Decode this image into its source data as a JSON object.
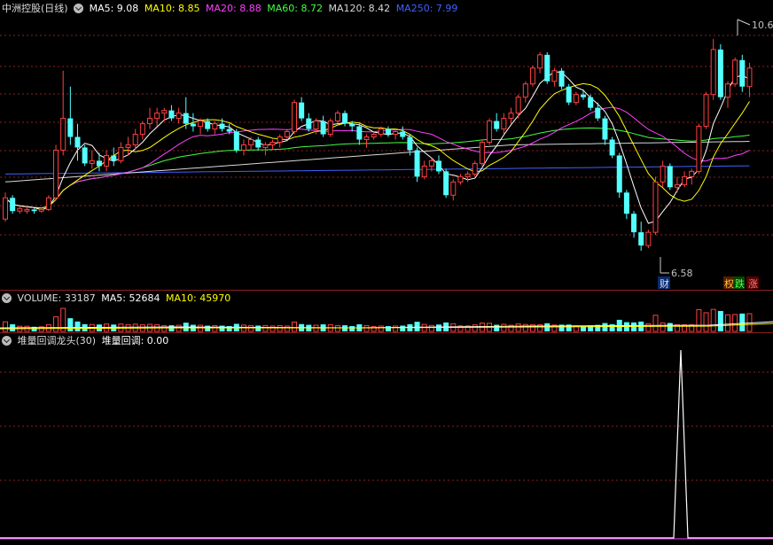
{
  "colors": {
    "up": "#ff4040",
    "down": "#54ffff",
    "grid": "#8a2020",
    "ma5": "#ffffff",
    "ma10": "#ffff00",
    "ma20": "#ff40ff",
    "ma60": "#40ff40",
    "ma120": "#d8d8d8",
    "ma250": "#4060ff"
  },
  "main": {
    "stock_name": "中洲控股(日线)",
    "ma5_label": "MA5: 9.08",
    "ma10_label": "MA10: 8.85",
    "ma20_label": "MA20: 8.88",
    "ma60_label": "MA60: 8.72",
    "ma120_label": "MA120: 8.42",
    "ma250_label": "MA250: 7.99",
    "high_mark": "10.6",
    "low_mark": "6.58",
    "badge_cai": "财",
    "badge_quan": "权",
    "badge_die": "跌",
    "badge_zhang": "涨"
  },
  "volume": {
    "title": "VOLUME: 33187",
    "ma5_label": "MA5: 52684",
    "ma10_label": "MA10: 45970"
  },
  "indicator": {
    "title": "堆量回调龙头(30)",
    "value_label": "堆量回调: 0.00"
  },
  "chart_data": [
    {
      "type": "candlestick",
      "ylim": [
        6.4,
        11.0
      ],
      "candles": [
        [
          7.2,
          7.7,
          7.15,
          7.6
        ],
        [
          7.6,
          7.65,
          7.3,
          7.35
        ],
        [
          7.35,
          7.45,
          7.3,
          7.4
        ],
        [
          7.35,
          7.45,
          7.3,
          7.38
        ],
        [
          7.38,
          7.4,
          7.3,
          7.35
        ],
        [
          7.35,
          7.42,
          7.32,
          7.38
        ],
        [
          7.38,
          7.65,
          7.35,
          7.6
        ],
        [
          7.6,
          8.6,
          7.55,
          8.5
        ],
        [
          8.5,
          10.0,
          8.4,
          9.1
        ],
        [
          9.1,
          9.7,
          8.6,
          8.75
        ],
        [
          8.75,
          9.0,
          8.3,
          8.55
        ],
        [
          8.55,
          8.6,
          8.2,
          8.25
        ],
        [
          8.25,
          8.5,
          8.15,
          8.3
        ],
        [
          8.3,
          8.45,
          8.1,
          8.2
        ],
        [
          8.2,
          8.5,
          8.1,
          8.4
        ],
        [
          8.4,
          8.55,
          8.2,
          8.3
        ],
        [
          8.3,
          8.65,
          8.25,
          8.55
        ],
        [
          8.55,
          8.75,
          8.4,
          8.6
        ],
        [
          8.6,
          8.9,
          8.5,
          8.8
        ],
        [
          8.8,
          9.05,
          8.7,
          9.0
        ],
        [
          9.0,
          9.3,
          8.9,
          9.1
        ],
        [
          9.1,
          9.3,
          8.95,
          9.2
        ],
        [
          9.2,
          9.3,
          9.05,
          9.25
        ],
        [
          9.25,
          9.35,
          9.05,
          9.1
        ],
        [
          9.1,
          9.3,
          9.0,
          9.2
        ],
        [
          9.2,
          9.5,
          8.9,
          9.0
        ],
        [
          9.0,
          9.2,
          8.85,
          8.95
        ],
        [
          8.95,
          9.1,
          8.8,
          9.05
        ],
        [
          9.05,
          9.1,
          8.85,
          8.9
        ],
        [
          8.9,
          9.05,
          8.8,
          9.0
        ],
        [
          9.0,
          9.1,
          8.85,
          8.9
        ],
        [
          8.9,
          9.0,
          8.8,
          8.85
        ],
        [
          8.85,
          8.9,
          8.45,
          8.5
        ],
        [
          8.5,
          8.7,
          8.4,
          8.6
        ],
        [
          8.6,
          8.75,
          8.5,
          8.7
        ],
        [
          8.7,
          8.75,
          8.5,
          8.55
        ],
        [
          8.55,
          8.65,
          8.4,
          8.6
        ],
        [
          8.6,
          8.7,
          8.5,
          8.65
        ],
        [
          8.65,
          8.8,
          8.55,
          8.75
        ],
        [
          8.75,
          8.9,
          8.7,
          8.85
        ],
        [
          8.85,
          9.45,
          8.8,
          9.4
        ],
        [
          9.4,
          9.5,
          9.05,
          9.1
        ],
        [
          9.1,
          9.2,
          8.85,
          8.9
        ],
        [
          8.9,
          9.1,
          8.8,
          9.05
        ],
        [
          9.05,
          9.15,
          8.75,
          8.8
        ],
        [
          8.8,
          9.1,
          8.75,
          9.05
        ],
        [
          9.05,
          9.25,
          9.0,
          9.2
        ],
        [
          9.2,
          9.25,
          8.95,
          9.0
        ],
        [
          9.0,
          9.05,
          8.85,
          8.95
        ],
        [
          8.95,
          9.0,
          8.6,
          8.7
        ],
        [
          8.7,
          8.8,
          8.55,
          8.75
        ],
        [
          8.75,
          8.85,
          8.7,
          8.8
        ],
        [
          8.8,
          8.95,
          8.75,
          8.9
        ],
        [
          8.9,
          8.95,
          8.75,
          8.8
        ],
        [
          8.8,
          8.9,
          8.7,
          8.85
        ],
        [
          8.85,
          8.95,
          8.7,
          8.75
        ],
        [
          8.75,
          8.8,
          8.4,
          8.5
        ],
        [
          8.5,
          8.55,
          7.9,
          8.0
        ],
        [
          8.0,
          8.3,
          7.95,
          8.2
        ],
        [
          8.2,
          8.35,
          8.1,
          8.3
        ],
        [
          8.3,
          8.4,
          8.05,
          8.1
        ],
        [
          8.1,
          8.15,
          7.6,
          7.65
        ],
        [
          7.65,
          7.95,
          7.55,
          7.9
        ],
        [
          7.9,
          8.05,
          7.85,
          8.0
        ],
        [
          8.0,
          8.1,
          7.9,
          8.05
        ],
        [
          8.05,
          8.3,
          8.0,
          8.25
        ],
        [
          8.25,
          8.7,
          8.2,
          8.65
        ],
        [
          8.65,
          9.1,
          8.6,
          9.05
        ],
        [
          9.05,
          9.2,
          8.85,
          8.9
        ],
        [
          8.9,
          9.2,
          8.8,
          9.1
        ],
        [
          9.1,
          9.3,
          9.0,
          9.2
        ],
        [
          9.2,
          9.55,
          9.1,
          9.5
        ],
        [
          9.5,
          9.8,
          9.4,
          9.75
        ],
        [
          9.75,
          10.1,
          9.7,
          10.05
        ],
        [
          10.05,
          10.35,
          9.95,
          10.3
        ],
        [
          10.3,
          10.35,
          9.75,
          9.8
        ],
        [
          9.8,
          10.05,
          9.7,
          10.0
        ],
        [
          10.0,
          10.05,
          9.65,
          9.7
        ],
        [
          9.7,
          9.75,
          9.35,
          9.4
        ],
        [
          9.4,
          9.6,
          9.35,
          9.55
        ],
        [
          9.55,
          9.65,
          9.45,
          9.5
        ],
        [
          9.5,
          9.55,
          9.25,
          9.3
        ],
        [
          9.3,
          9.4,
          9.05,
          9.1
        ],
        [
          9.1,
          9.15,
          8.6,
          8.7
        ],
        [
          8.7,
          8.75,
          8.35,
          8.4
        ],
        [
          8.4,
          8.45,
          7.6,
          7.7
        ],
        [
          7.7,
          7.75,
          7.2,
          7.3
        ],
        [
          7.3,
          7.35,
          6.85,
          6.95
        ],
        [
          6.95,
          7.15,
          6.6,
          6.7
        ],
        [
          6.7,
          7.0,
          6.65,
          6.95
        ],
        [
          6.95,
          8.0,
          6.9,
          7.9
        ],
        [
          7.9,
          8.3,
          7.8,
          8.2
        ],
        [
          8.2,
          8.25,
          7.75,
          7.8
        ],
        [
          7.8,
          8.0,
          7.7,
          7.85
        ],
        [
          7.85,
          8.1,
          7.8,
          8.0
        ],
        [
          8.0,
          8.15,
          7.85,
          8.1
        ],
        [
          8.1,
          9.0,
          8.05,
          8.95
        ],
        [
          8.95,
          9.6,
          8.9,
          9.55
        ],
        [
          9.55,
          10.6,
          9.45,
          10.4
        ],
        [
          10.4,
          10.5,
          9.45,
          9.5
        ],
        [
          9.5,
          9.8,
          9.3,
          9.75
        ],
        [
          9.75,
          10.25,
          9.7,
          10.2
        ],
        [
          10.2,
          10.3,
          9.6,
          9.7
        ],
        [
          9.7,
          10.15,
          9.5,
          10.05
        ]
      ]
    },
    {
      "type": "bar",
      "name": "VOLUME"
    },
    {
      "type": "line",
      "name": "堆量回调",
      "values": []
    }
  ]
}
